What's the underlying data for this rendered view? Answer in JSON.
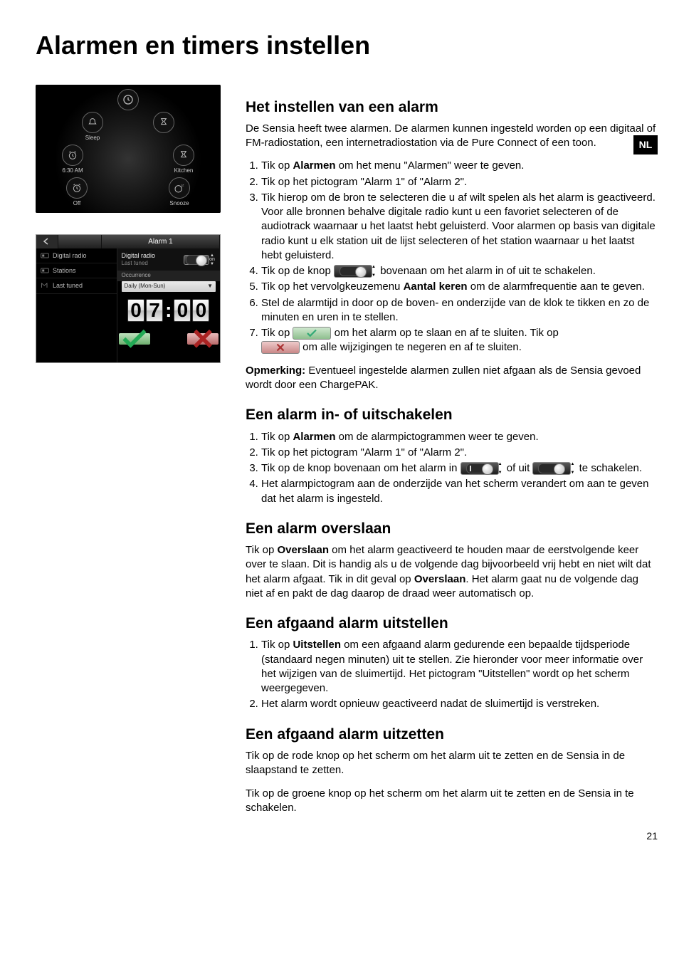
{
  "title": "Alarmen en timers instellen",
  "lang_tab": "NL",
  "page_number": "21",
  "shot1": {
    "items": [
      {
        "label": "",
        "icon": "clock"
      },
      {
        "label": "Sleep",
        "icon": "sleep"
      },
      {
        "label": "",
        "icon": "hourglass"
      },
      {
        "label": "6:30 AM",
        "icon": "alarm"
      },
      {
        "label": "Kitchen",
        "icon": "hourglass"
      },
      {
        "label": "Off",
        "icon": "alarm"
      },
      {
        "label": "Snooze",
        "icon": "snooze"
      }
    ]
  },
  "shot2": {
    "header_tab": "Alarm 1",
    "left_items": [
      "Digital radio",
      "Stations",
      "Last tuned"
    ],
    "source_line1": "Digital radio",
    "source_line2": "Last tuned",
    "source_state": "on",
    "occurrence_label": "Occurrence",
    "occurrence_value": "Daily (Mon-Sun)",
    "digits": [
      "0",
      "7",
      "0",
      "0"
    ]
  },
  "sec1": {
    "heading": "Het instellen van een alarm",
    "intro": "De Sensia heeft twee alarmen. De alarmen kunnen ingesteld worden op een digitaal of FM-radiostation, een internetradiostation via de Pure Connect of een toon.",
    "li1a": "Tik op ",
    "li1b": "Alarmen",
    "li1c": " om het menu \"Alarmen\" weer te geven.",
    "li2": "Tik op het pictogram \"Alarm 1\" of \"Alarm 2\".",
    "li3": "Tik hierop om de bron te selecteren die u af wilt spelen als het alarm is geactiveerd. Voor alle bronnen behalve digitale radio kunt u een favoriet selecteren of de audiotrack waarnaar u het laatst hebt geluisterd. Voor alarmen op basis van digitale radio kunt u elk station uit de lijst selecteren of het station waarnaar u het laatst hebt geluisterd.",
    "li4a": "Tik op de knop ",
    "li4b": " bovenaan om het alarm in of uit te schakelen.",
    "li5a": "Tik op het vervolgkeuzemenu ",
    "li5b": "Aantal keren",
    "li5c": " om de alarmfrequentie aan te geven.",
    "li6": "Stel de alarmtijd in door op de boven- en onderzijde van de klok te tikken en zo de minuten en uren in te stellen.",
    "li7a": "Tik op ",
    "li7b": " om het alarm op te slaan en af te sluiten. Tik op ",
    "li7c": " om alle wijzigingen te negeren en af te sluiten.",
    "note_label": "Opmerking:",
    "note_body": " Eventueel ingestelde alarmen zullen niet afgaan als de Sensia gevoed wordt door een ChargePAK."
  },
  "sec2": {
    "heading": "Een alarm in- of uitschakelen",
    "li1a": "Tik op ",
    "li1b": "Alarmen",
    "li1c": " om de alarmpictogrammen weer te geven.",
    "li2": "Tik op het pictogram \"Alarm 1\" of \"Alarm 2\".",
    "li3a": "Tik op de knop bovenaan om het alarm in ",
    "li3b": " of uit ",
    "li3c": " te schakelen.",
    "li4": "Het alarmpictogram aan de onderzijde van het scherm verandert om aan te geven dat het alarm is ingesteld."
  },
  "sec3": {
    "heading": "Een alarm overslaan",
    "p_a": "Tik op ",
    "p_b": "Overslaan",
    "p_c": " om het alarm geactiveerd te houden maar de eerstvolgende keer over te slaan. Dit is handig als u de volgende dag bijvoorbeeld vrij hebt en niet wilt dat het alarm afgaat. Tik in dit geval op ",
    "p_d": "Overslaan",
    "p_e": ". Het alarm gaat nu de volgende dag niet af en pakt de dag daarop de draad weer automatisch op."
  },
  "sec4": {
    "heading": "Een afgaand alarm uitstellen",
    "li1a": "Tik op ",
    "li1b": "Uitstellen",
    "li1c": " om een afgaand alarm gedurende een bepaalde tijdsperiode (standaard negen minuten) uit te stellen.  Zie hieronder voor meer informatie over het wijzigen van de sluimertijd. Het pictogram \"Uitstellen\" wordt op het scherm weergegeven.",
    "li2": "Het alarm wordt opnieuw geactiveerd nadat de sluimertijd is verstreken."
  },
  "sec5": {
    "heading": "Een afgaand alarm uitzetten",
    "p1": "Tik op de rode knop op het scherm om het alarm uit te zetten en de Sensia in de slaapstand te zetten.",
    "p2": "Tik op de groene knop op het scherm om het alarm uit te zetten en de Sensia in te schakelen."
  }
}
